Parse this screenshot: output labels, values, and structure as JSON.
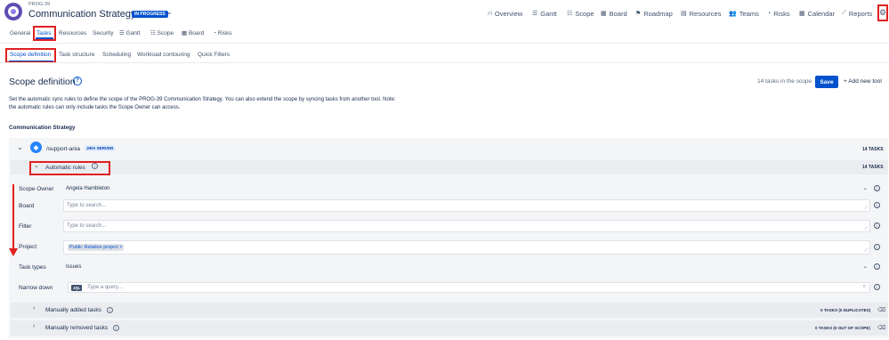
{
  "header": {
    "project_key": "PROG-39",
    "title": "Communication Strategy",
    "status": "IN PROGRESS",
    "nav": [
      {
        "icon": "hierarchy-icon",
        "glyph": "⛙",
        "label": "Overview"
      },
      {
        "icon": "gantt-icon",
        "glyph": "☰",
        "label": "Gantt"
      },
      {
        "icon": "scope-icon",
        "glyph": "☷",
        "label": "Scope"
      },
      {
        "icon": "board-icon",
        "glyph": "▦",
        "label": "Board"
      },
      {
        "icon": "roadmap-icon",
        "glyph": "⚑",
        "label": "Roadmap"
      },
      {
        "icon": "resources-icon",
        "glyph": "▤",
        "label": "Resources"
      },
      {
        "icon": "teams-icon",
        "glyph": "👥",
        "label": "Teams"
      },
      {
        "icon": "risks-icon",
        "glyph": "◔",
        "label": "Risks"
      },
      {
        "icon": "calendar-icon",
        "glyph": "▦",
        "label": "Calendar"
      },
      {
        "icon": "reports-icon",
        "glyph": "⟋",
        "label": "Reports"
      }
    ]
  },
  "tabs": {
    "general": "General",
    "tasks": "Tasks",
    "resources": "Resources",
    "security": "Security",
    "gantt": "Gantt",
    "scope": "Scope",
    "board": "Board",
    "risks": "Risks"
  },
  "subtabs": {
    "scope_definition": "Scope definition",
    "task_structure": "Task structure",
    "scheduling": "Scheduling",
    "workload_contouring": "Workload contouring",
    "quick_filters": "Quick Filters"
  },
  "page": {
    "heading": "Scope definition",
    "help": "?",
    "task_count": "14 tasks in the scope",
    "save_label": "Save",
    "add_tool_label": "+ Add new tool",
    "description": "Set the automatic sync rules to define the scope of the PROG-39 Communication Strategy. You can also extend the scope by syncing tasks from another tool. Note: the automatic rules can only include tasks the Scope Owner can access.",
    "section_label": "Communication Strategy"
  },
  "source": {
    "name": "/support-ania",
    "badge": "JIRA SERVER",
    "count": "14 TASKS"
  },
  "rules": {
    "label": "Automatic rules",
    "count": "14 TASKS",
    "info": "i",
    "fields": {
      "scope_owner": {
        "label": "Scope Owner",
        "value": "Angela Hambleton"
      },
      "board": {
        "label": "Board",
        "placeholder": "Type to search..."
      },
      "filter": {
        "label": "Filter",
        "placeholder": "Type to search..."
      },
      "project": {
        "label": "Project",
        "chip": "Public Relation project",
        "chip_remove": "×"
      },
      "task_types": {
        "label": "Task types",
        "value": "Issues"
      },
      "narrow_down": {
        "label": "Narrow down",
        "tag": "JQL",
        "placeholder": "Type a query..."
      }
    }
  },
  "bottom": {
    "manual_added": {
      "label": "Manually added tasks",
      "count": "0 TASKS (0 DUPLICATES)"
    },
    "manual_removed": {
      "label": "Manually removed tasks",
      "count": "0 TASKS (0 OUT OF SCOPE)"
    }
  }
}
